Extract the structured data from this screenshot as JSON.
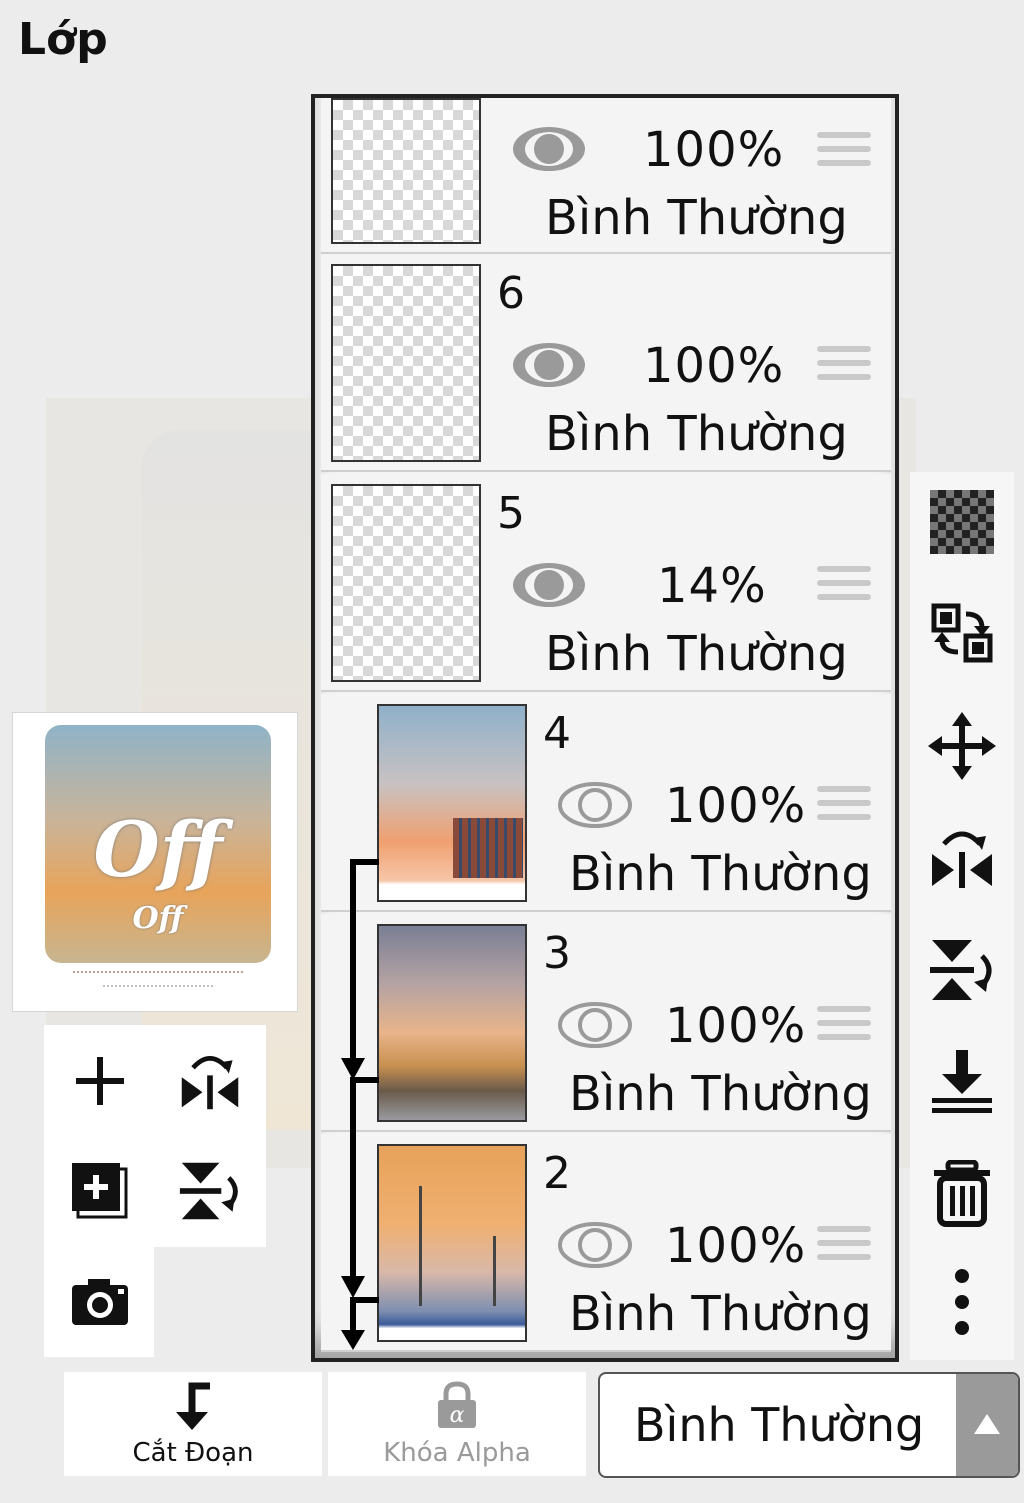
{
  "title": "Lớp",
  "layers": [
    {
      "number": "",
      "visible": true,
      "opacity": "100%",
      "mode": "Bình Thường",
      "thumb": "transparent-text"
    },
    {
      "number": "6",
      "visible": true,
      "opacity": "100%",
      "mode": "Bình Thường",
      "thumb": "transparent-text"
    },
    {
      "number": "5",
      "visible": true,
      "opacity": "14%",
      "mode": "Bình Thường",
      "thumb": "transparent"
    },
    {
      "number": "4",
      "visible": true,
      "opacity": "100%",
      "mode": "Bình Thường",
      "thumb": "photo-city-sunset",
      "clipped": true
    },
    {
      "number": "3",
      "visible": true,
      "opacity": "100%",
      "mode": "Bình Thường",
      "thumb": "photo-clouds-hill",
      "clipped": true
    },
    {
      "number": "2",
      "visible": true,
      "opacity": "100%",
      "mode": "Bình Thường",
      "thumb": "photo-pier-sunset",
      "clipped": true
    }
  ],
  "right_toolbar": [
    "transparency-grid-icon",
    "swap-layer-icon",
    "move-icon",
    "flip-horizontal-icon",
    "flip-vertical-icon",
    "merge-down-icon",
    "trash-icon",
    "more-vertical-icon"
  ],
  "left_tools": [
    "add-layer-icon",
    "flip-horizontal-icon",
    "add-special-layer-icon",
    "flip-vertical-icon",
    "camera-icon"
  ],
  "preview": {
    "big_text": "Off",
    "small_text": "Off"
  },
  "bottom": {
    "clipping_label": "Cắt Đoạn",
    "alpha_lock_label": "Khóa Alpha",
    "blend_mode": "Bình Thường"
  },
  "colors": {
    "panel_border": "#222222",
    "background": "#ececec",
    "eye_fill": "#9a9a9a"
  }
}
